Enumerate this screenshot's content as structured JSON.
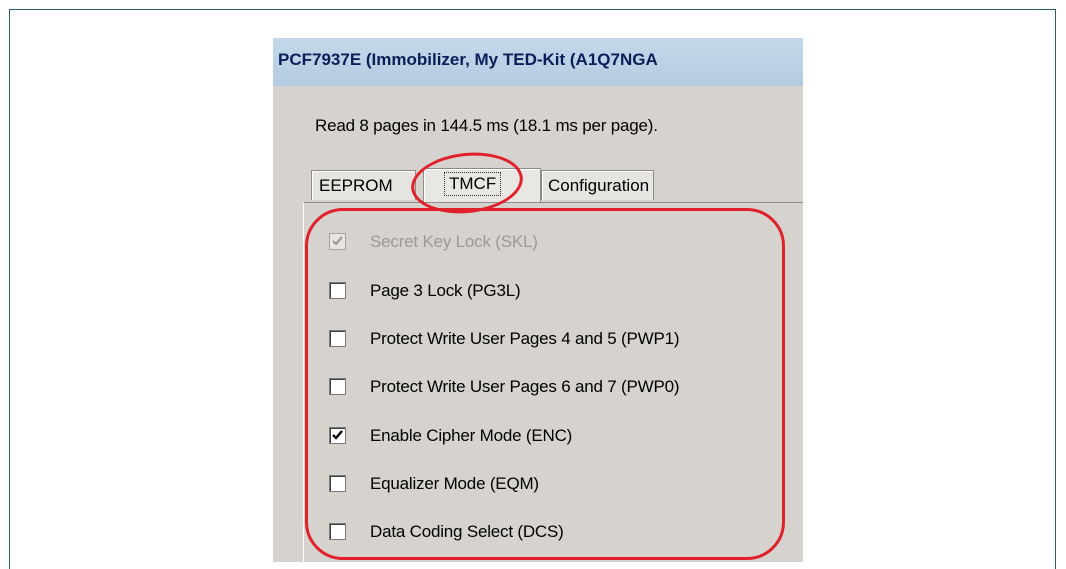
{
  "window": {
    "title": "PCF7937E (Immobilizer, My TED-Kit (A1Q7NGA"
  },
  "status_text": "Read 8 pages in 144.5 ms (18.1 ms per page).",
  "tabs": [
    {
      "label": "EEPROM",
      "active": false
    },
    {
      "label": "TMCF",
      "active": true
    },
    {
      "label": "Configuration",
      "active": false
    }
  ],
  "options": [
    {
      "label": "Secret Key Lock (SKL)",
      "checked": true,
      "disabled": true
    },
    {
      "label": "Page 3 Lock (PG3L)",
      "checked": false,
      "disabled": false
    },
    {
      "label": "Protect Write User Pages 4 and 5 (PWP1)",
      "checked": false,
      "disabled": false
    },
    {
      "label": "Protect Write User Pages 6 and 7 (PWP0)",
      "checked": false,
      "disabled": false
    },
    {
      "label": "Enable Cipher Mode (ENC)",
      "checked": true,
      "disabled": false
    },
    {
      "label": "Equalizer Mode (EQM)",
      "checked": false,
      "disabled": false
    },
    {
      "label": "Data Coding Select (DCS)",
      "checked": false,
      "disabled": false
    }
  ],
  "colors": {
    "highlight": "#e0202a",
    "title_bar": "#b9cfe5",
    "dialog_bg": "#d6d3ce"
  }
}
